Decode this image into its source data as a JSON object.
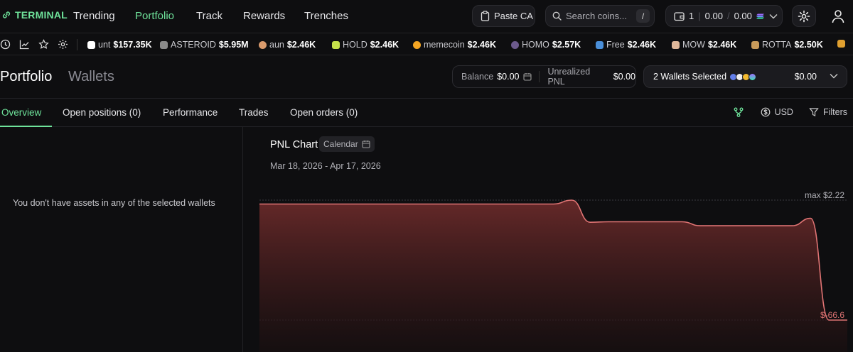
{
  "brand": "TERMINAL",
  "nav": [
    "Trending",
    "Portfolio",
    "Track",
    "Rewards",
    "Trenches"
  ],
  "paste_ca": "Paste CA",
  "search": {
    "placeholder": "Search coins...",
    "shortcut": "/"
  },
  "wallet_pill": {
    "count": "1",
    "sol": "0.00",
    "slash": "/",
    "usd": "0.00"
  },
  "ticker": [
    {
      "name": "unt",
      "value": "$157.35K",
      "color": "#ffffff"
    },
    {
      "name": "ASTEROID",
      "value": "$5.95M",
      "color": "#8a8a8a"
    },
    {
      "name": "aun",
      "value": "$2.46K",
      "color": "#d99a6c"
    },
    {
      "name": "HOLD",
      "value": "$2.46K",
      "color": "#c6e04b"
    },
    {
      "name": "memecoin",
      "value": "$2.46K",
      "color": "#f5a623"
    },
    {
      "name": "HOMO",
      "value": "$2.57K",
      "color": "#6c5a8c"
    },
    {
      "name": "Free",
      "value": "$2.46K",
      "color": "#4a8fd9"
    },
    {
      "name": "MOW",
      "value": "$2.46K",
      "color": "#e0b89a"
    },
    {
      "name": "ROTTA",
      "value": "$2.50K",
      "color": "#c89a5a"
    },
    {
      "name": "",
      "value": "",
      "color": "#e0a030"
    }
  ],
  "portfolio": {
    "title": "Portfolio",
    "wallets_tab": "Wallets",
    "balance_label": "Balance",
    "balance_value": "$0.00",
    "upnl_label": "Unrealized PNL",
    "upnl_value": "$0.00",
    "wallets_selected": "2 Wallets Selected",
    "wallets_value": "$0.00"
  },
  "tabs": [
    "Overview",
    "Open positions (0)",
    "Performance",
    "Trades",
    "Open orders (0)"
  ],
  "tab_tools": {
    "currency": "USD",
    "filters": "Filters"
  },
  "empty_message": "You don't have assets in any of the selected wallets",
  "pnl": {
    "title": "PNL Chart",
    "calendar": "Calendar",
    "date_range": "Mar 18, 2026 - Apr 17, 2026",
    "max_label": "max $2.22",
    "min_label": "$-66.6"
  },
  "chart_data": {
    "type": "area",
    "ylim": [
      -66.6,
      2.22
    ],
    "values": [
      0,
      0,
      0,
      0,
      0,
      0,
      0,
      0,
      0,
      0,
      0,
      0,
      0,
      0,
      0,
      0,
      0,
      2.22,
      -10.5,
      -10.2,
      -10.2,
      -10.2,
      -10.2,
      -10.2,
      -12.5,
      -12.5,
      -12.5,
      -12.5,
      -12.5,
      -12.5,
      -8.2,
      -66.6,
      -66.6
    ]
  },
  "colors": {
    "accent": "#6fe39b",
    "pnl_line": "#e07474"
  }
}
